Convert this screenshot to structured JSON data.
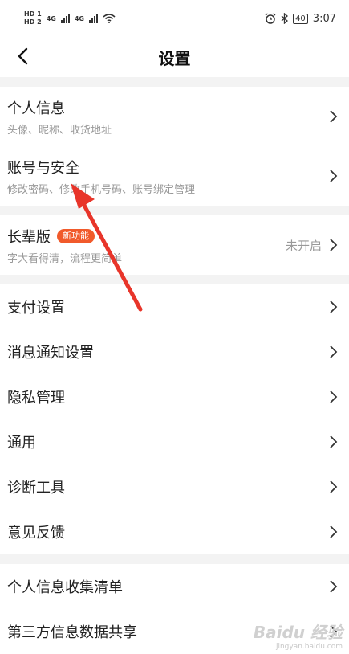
{
  "status_bar": {
    "hd1": "HD 1",
    "hd2": "HD 2",
    "net1": "4G",
    "net2": "4G",
    "battery": "40",
    "time": "3:07"
  },
  "header": {
    "title": "设置"
  },
  "sections": [
    {
      "items": [
        {
          "label": "个人信息",
          "sub": "头像、昵称、收货地址"
        },
        {
          "label": "账号与安全",
          "sub": "修改密码、修改手机号码、账号绑定管理"
        }
      ]
    },
    {
      "items": [
        {
          "label": "长辈版",
          "badge": "新功能",
          "sub": "字大看得清，流程更简单",
          "status": "未开启"
        }
      ]
    },
    {
      "items": [
        {
          "label": "支付设置"
        },
        {
          "label": "消息通知设置"
        },
        {
          "label": "隐私管理"
        },
        {
          "label": "通用"
        },
        {
          "label": "诊断工具"
        },
        {
          "label": "意见反馈"
        }
      ]
    },
    {
      "items": [
        {
          "label": "个人信息收集清单"
        },
        {
          "label": "第三方信息数据共享"
        }
      ]
    }
  ],
  "watermark": {
    "brand": "Baidu 经验",
    "sub": "jingyan.baidu.com"
  },
  "colors": {
    "badge": "#f15a2b",
    "annotation_arrow": "#e8352a",
    "section_gap": "#f3f3f3"
  }
}
